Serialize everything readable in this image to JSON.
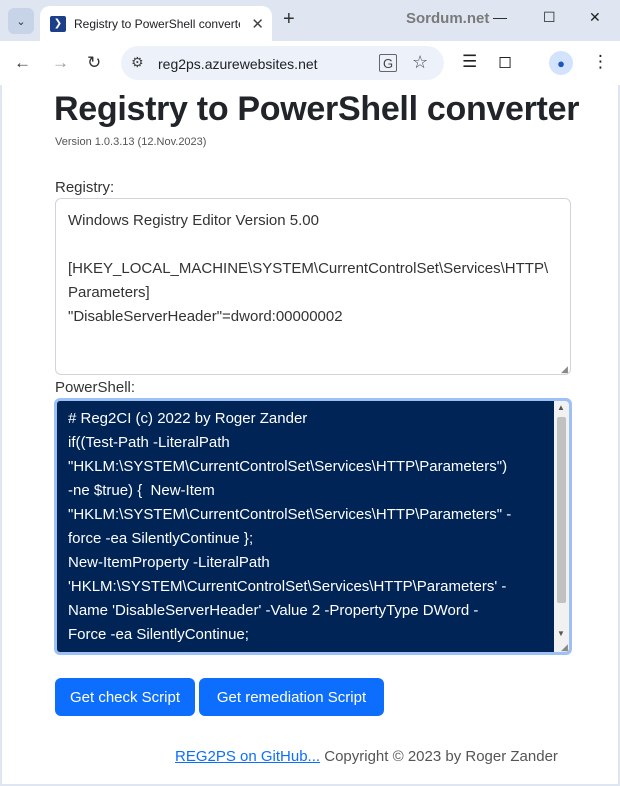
{
  "browser": {
    "tab_title": "Registry to PowerShell converte",
    "watermark": "Sordum.net",
    "url": "reg2ps.azurewebsites.net"
  },
  "page": {
    "title": "Registry to PowerShell converter",
    "version": "Version 1.0.3.13 (12.Nov.2023)",
    "registry_label": "Registry:",
    "registry_value": "Windows Registry Editor Version 5.00\n\n[HKEY_LOCAL_MACHINE\\SYSTEM\\CurrentControlSet\\Services\\HTTP\\\nParameters]\n\"DisableServerHeader\"=dword:00000002",
    "powershell_label": "PowerShell:",
    "powershell_value": "# Reg2CI (c) 2022 by Roger Zander\nif((Test-Path -LiteralPath\n\"HKLM:\\SYSTEM\\CurrentControlSet\\Services\\HTTP\\Parameters\")\n-ne $true) {  New-Item\n\"HKLM:\\SYSTEM\\CurrentControlSet\\Services\\HTTP\\Parameters\" -\nforce -ea SilentlyContinue };\nNew-ItemProperty -LiteralPath\n'HKLM:\\SYSTEM\\CurrentControlSet\\Services\\HTTP\\Parameters' -\nName 'DisableServerHeader' -Value 2 -PropertyType DWord -\nForce -ea SilentlyContinue;",
    "check_button": "Get check Script",
    "remediation_button": "Get remediation Script",
    "footer_link": "REG2PS on GitHub...",
    "footer_text": " Copyright © 2023 by Roger Zander"
  },
  "icons": {
    "tab_search": "chevron-down-icon",
    "favicon": "powershell-icon",
    "close": "close-icon",
    "new_tab": "plus-icon",
    "back": "arrow-left-icon",
    "forward": "arrow-right-icon",
    "reload": "reload-icon",
    "site_info": "tune-icon",
    "translate": "translate-icon",
    "bookmark": "star-icon",
    "extensions_stack": "layers-icon",
    "extensions": "puzzle-icon",
    "profile": "person-icon",
    "menu": "kebab-menu-icon"
  },
  "colors": {
    "accent": "#0d6efd",
    "powershell_bg": "#012456"
  }
}
